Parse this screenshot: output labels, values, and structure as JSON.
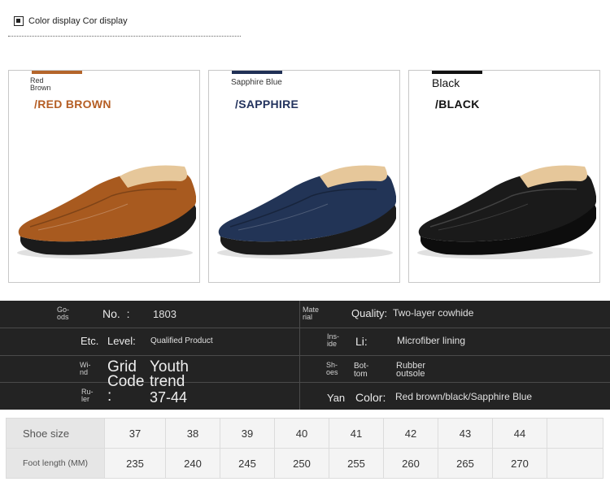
{
  "header": {
    "title": "Color display Cor display"
  },
  "colors": [
    {
      "small_label": "Red\nBrown",
      "big_label": "/RED BROWN",
      "swatch_color": "#b4652a",
      "label_color": "#b55e24",
      "shoe_color": "#a85a1f"
    },
    {
      "small_label": "Sapphire Blue",
      "big_label": "/SAPPHIRE",
      "swatch_color": "#1f2f55",
      "label_color": "#23335e",
      "shoe_color": "#223456"
    },
    {
      "small_label": "Black",
      "big_label": "/BLACK",
      "swatch_color": "#111111",
      "label_color": "#111111",
      "shoe_color": "#1a1a1a"
    }
  ],
  "specs": {
    "goods_no": {
      "tiny": "Go-\nods",
      "label": "No.  :",
      "value": "1803"
    },
    "material_quality": {
      "tiny": "Mate\nrial",
      "label": "Quality:",
      "value": "Two-layer cowhide"
    },
    "etc_level": {
      "tiny": "Etc.",
      "label": "Level:",
      "value": "Qualified Product"
    },
    "inside_li": {
      "tiny": "Ins-\nide",
      "label": "Li:",
      "value": "Microfiber lining"
    },
    "wind_grid": {
      "tiny": "Wi-\nnd",
      "label": "Grid\nCode\n:",
      "value": "Youth\ntrend"
    },
    "shoes_bottom": {
      "tiny": "Sh-\noes",
      "label": "Bot-\ntom",
      "value": "Rubber\noutsole"
    },
    "ruler": {
      "tiny": "Ru-\nler",
      "value": "37-44"
    },
    "yan_color": {
      "tiny": "Yan",
      "label": "Color:",
      "value": "Red brown/black/Sapphire Blue"
    }
  },
  "size_table": {
    "shoe_size_label": "Shoe size",
    "foot_length_label": "Foot length (MM)",
    "sizes": [
      "37",
      "38",
      "39",
      "40",
      "41",
      "42",
      "43",
      "44"
    ],
    "lengths": [
      "235",
      "240",
      "245",
      "250",
      "255",
      "260",
      "265",
      "270"
    ]
  }
}
